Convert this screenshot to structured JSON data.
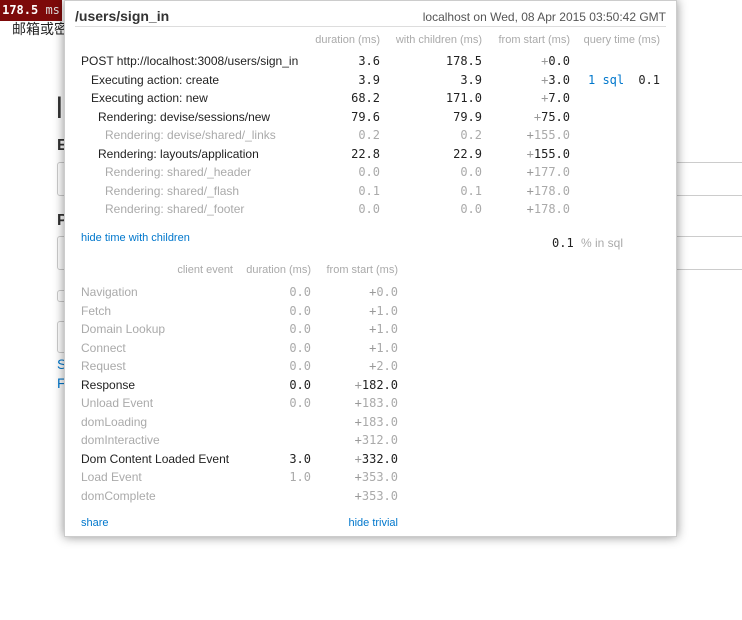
{
  "badge": {
    "value": "178.5",
    "unit": "ms"
  },
  "background": {
    "text": "邮箱或密",
    "heading": "l",
    "label_email": "E",
    "label_password": "P",
    "link1": "S",
    "link2": "F"
  },
  "popup": {
    "title": "/users/sign_in",
    "host": "localhost on Wed, 08 Apr 2015 03:50:42 GMT",
    "headers": [
      "duration (ms)",
      "with children (ms)",
      "from start (ms)",
      "query time (ms)"
    ],
    "rows": [
      {
        "label": "POST http://localhost:3008/users/sign_in",
        "indent": 0,
        "trivial": false,
        "duration": "3.6",
        "with_children": "178.5",
        "from_start": "0.0"
      },
      {
        "label": "Executing action: create",
        "indent": 1,
        "trivial": false,
        "duration": "3.9",
        "with_children": "3.9",
        "from_start": "3.0",
        "sql": "1 sql",
        "query_time": "0.1"
      },
      {
        "label": "Executing action: new",
        "indent": 1,
        "trivial": false,
        "duration": "68.2",
        "with_children": "171.0",
        "from_start": "7.0"
      },
      {
        "label": "Rendering: devise/sessions/new",
        "indent": 2,
        "trivial": false,
        "duration": "79.6",
        "with_children": "79.9",
        "from_start": "75.0"
      },
      {
        "label": "Rendering: devise/shared/_links",
        "indent": 3,
        "trivial": true,
        "duration": "0.2",
        "with_children": "0.2",
        "from_start": "155.0"
      },
      {
        "label": "Rendering: layouts/application",
        "indent": 2,
        "trivial": false,
        "duration": "22.8",
        "with_children": "22.9",
        "from_start": "155.0"
      },
      {
        "label": "Rendering: shared/_header",
        "indent": 3,
        "trivial": true,
        "duration": "0.0",
        "with_children": "0.0",
        "from_start": "177.0"
      },
      {
        "label": "Rendering: shared/_flash",
        "indent": 3,
        "trivial": true,
        "duration": "0.1",
        "with_children": "0.1",
        "from_start": "178.0"
      },
      {
        "label": "Rendering: shared/_footer",
        "indent": 3,
        "trivial": true,
        "duration": "0.0",
        "with_children": "0.0",
        "from_start": "178.0"
      }
    ],
    "toggle_children": "hide time with children",
    "sql_percent": "0.1",
    "sql_percent_label": "% in sql",
    "client_headers": [
      "client event",
      "duration (ms)",
      "from start (ms)"
    ],
    "client_rows": [
      {
        "label": "Navigation",
        "trivial": true,
        "duration": "0.0",
        "from_start": "0.0"
      },
      {
        "label": "Fetch",
        "trivial": true,
        "duration": "0.0",
        "from_start": "1.0"
      },
      {
        "label": "Domain Lookup",
        "trivial": true,
        "duration": "0.0",
        "from_start": "1.0"
      },
      {
        "label": "Connect",
        "trivial": true,
        "duration": "0.0",
        "from_start": "1.0"
      },
      {
        "label": "Request",
        "trivial": true,
        "duration": "0.0",
        "from_start": "2.0"
      },
      {
        "label": "Response",
        "trivial": false,
        "duration": "0.0",
        "from_start": "182.0"
      },
      {
        "label": "Unload Event",
        "trivial": true,
        "duration": "0.0",
        "from_start": "183.0"
      },
      {
        "label": "domLoading",
        "trivial": true,
        "duration": "",
        "from_start": "183.0"
      },
      {
        "label": "domInteractive",
        "trivial": true,
        "duration": "",
        "from_start": "312.0"
      },
      {
        "label": "Dom Content Loaded Event",
        "trivial": false,
        "duration": "3.0",
        "from_start": "332.0"
      },
      {
        "label": "Load Event",
        "trivial": true,
        "duration": "1.0",
        "from_start": "353.0"
      },
      {
        "label": "domComplete",
        "trivial": true,
        "duration": "",
        "from_start": "353.0"
      }
    ],
    "share": "share",
    "hide_trivial": "hide trivial"
  }
}
